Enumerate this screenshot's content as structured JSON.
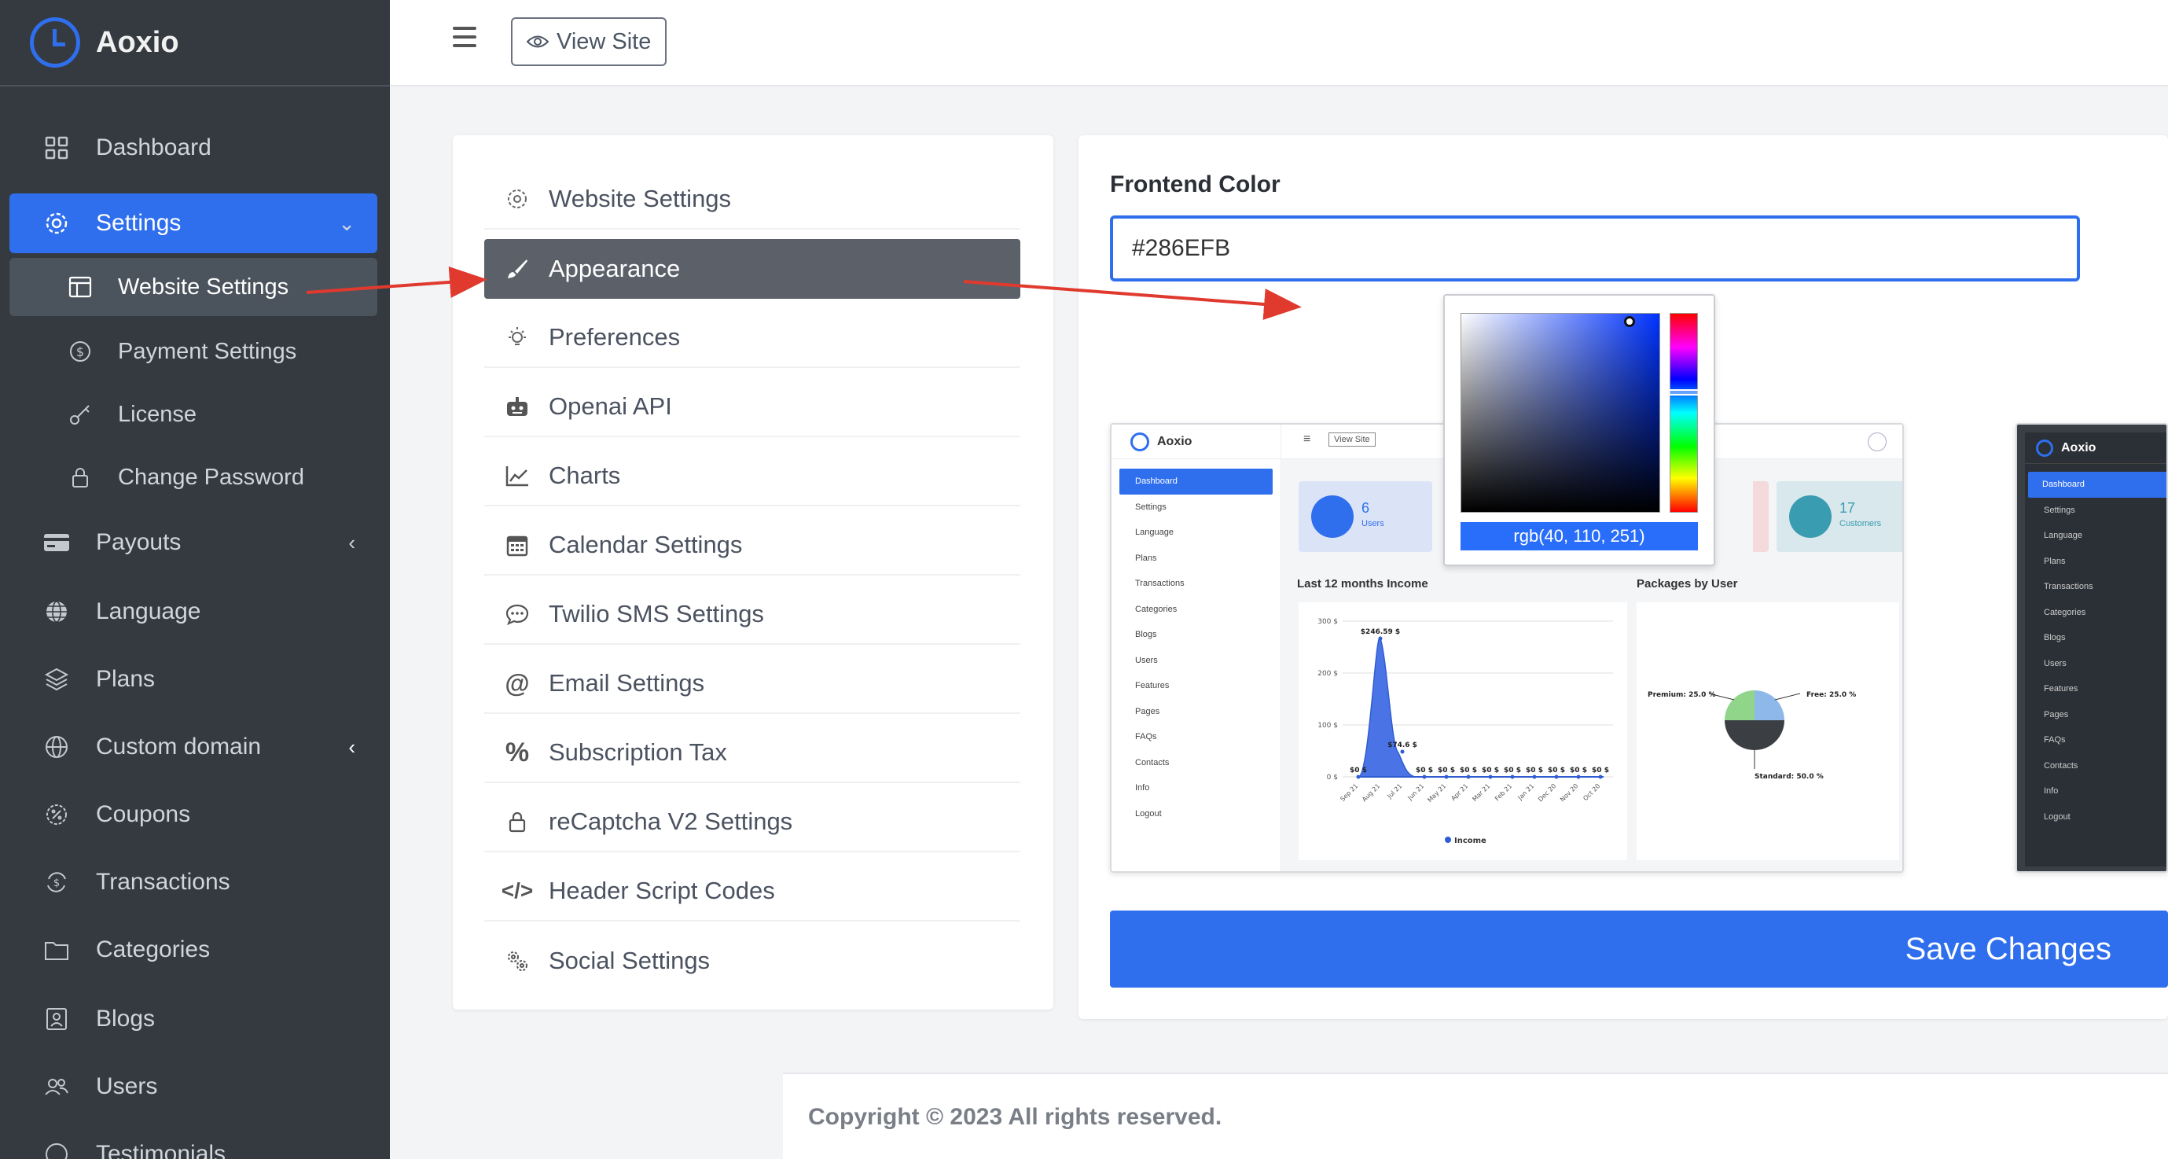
{
  "brand": {
    "name": "Aoxio"
  },
  "sidebar": {
    "items": [
      {
        "label": "Dashboard",
        "icon": "dashboard-icon"
      },
      {
        "label": "Settings",
        "icon": "gear-icon",
        "active": true
      },
      {
        "label": "Payouts",
        "icon": "credit-card-icon"
      },
      {
        "label": "Language",
        "icon": "globe-icon"
      },
      {
        "label": "Plans",
        "icon": "layers-icon"
      },
      {
        "label": "Custom domain",
        "icon": "globe-icon"
      },
      {
        "label": "Coupons",
        "icon": "coupon-icon"
      },
      {
        "label": "Transactions",
        "icon": "transactions-icon"
      },
      {
        "label": "Categories",
        "icon": "folder-icon"
      },
      {
        "label": "Blogs",
        "icon": "blog-icon"
      },
      {
        "label": "Users",
        "icon": "users-icon"
      },
      {
        "label": "Testimonials",
        "icon": "chat-icon"
      }
    ],
    "sub_items": [
      {
        "label": "Website Settings",
        "icon": "table-icon",
        "active": true
      },
      {
        "label": "Payment Settings",
        "icon": "dollar-circle-icon"
      },
      {
        "label": "License",
        "icon": "key-icon"
      },
      {
        "label": "Change Password",
        "icon": "lock-icon"
      }
    ]
  },
  "topbar": {
    "view_site": "View Site"
  },
  "settings_menu": [
    {
      "label": "Website Settings",
      "icon": "gear-icon"
    },
    {
      "label": "Appearance",
      "icon": "brush-icon",
      "active": true
    },
    {
      "label": "Preferences",
      "icon": "lightbulb-icon"
    },
    {
      "label": "Openai API",
      "icon": "robot-icon"
    },
    {
      "label": "Charts",
      "icon": "chart-line-icon"
    },
    {
      "label": "Calendar Settings",
      "icon": "calendar-icon"
    },
    {
      "label": "Twilio SMS Settings",
      "icon": "sms-icon"
    },
    {
      "label": "Email Settings",
      "icon": "at-icon"
    },
    {
      "label": "Subscription Tax",
      "icon": "percent-icon"
    },
    {
      "label": "reCaptcha V2 Settings",
      "icon": "lock-icon"
    },
    {
      "label": "Header Script Codes",
      "icon": "code-icon"
    },
    {
      "label": "Social Settings",
      "icon": "gears-icon"
    }
  ],
  "appearance": {
    "label": "Frontend Color",
    "value": "#286EFB",
    "picker_rgb": "rgb(40, 110, 251)",
    "accent": "#286efb"
  },
  "preview_light": {
    "brand": "Aoxio",
    "view_site": "View Site",
    "nav": [
      "Dashboard",
      "Settings",
      "Language",
      "Plans",
      "Transactions",
      "Categories",
      "Blogs",
      "Users",
      "Features",
      "Pages",
      "FAQs",
      "Contacts",
      "Info",
      "Logout"
    ],
    "stats": [
      {
        "num": "6",
        "label": "Users"
      },
      {
        "num": "17",
        "label": "Customers"
      }
    ],
    "income_title": "Last 12 months Income",
    "packages_title": "Packages by User",
    "income_y_ticks": [
      "300 $",
      "200 $",
      "100 $",
      "0 $"
    ],
    "income_x_ticks": [
      "Sep 21",
      "Aug 21",
      "Jul 21",
      "Jun 21",
      "May 21",
      "Apr 21",
      "Mar 21",
      "Feb 21",
      "Jan 21",
      "Dec 20",
      "Nov 20",
      "Oct 20"
    ],
    "income_labels": [
      "$0 $",
      "$246.59 $",
      "$74.6 $",
      "$0 $",
      "$0 $",
      "$0 $",
      "$0 $",
      "$0 $",
      "$0 $",
      "$0 $",
      "$0 $",
      "$0 $"
    ],
    "income_legend": "Income",
    "pie_labels": [
      "Premium: 25.0 %",
      "Free: 25.0 %",
      "Standard: 50.0 %"
    ]
  },
  "preview_dark": {
    "brand": "Aoxio",
    "nav": [
      "Dashboard",
      "Settings",
      "Language",
      "Plans",
      "Transactions",
      "Categories",
      "Blogs",
      "Users",
      "Features",
      "Pages",
      "FAQs",
      "Contacts",
      "Info",
      "Logout"
    ]
  },
  "save_label": "Save Changes",
  "footer": {
    "copyright": "Copyright © 2023 All rights reserved."
  },
  "colors": {
    "sidebar": "#343a40",
    "primary": "#2f6fed",
    "arrow": "#e03a2f"
  }
}
